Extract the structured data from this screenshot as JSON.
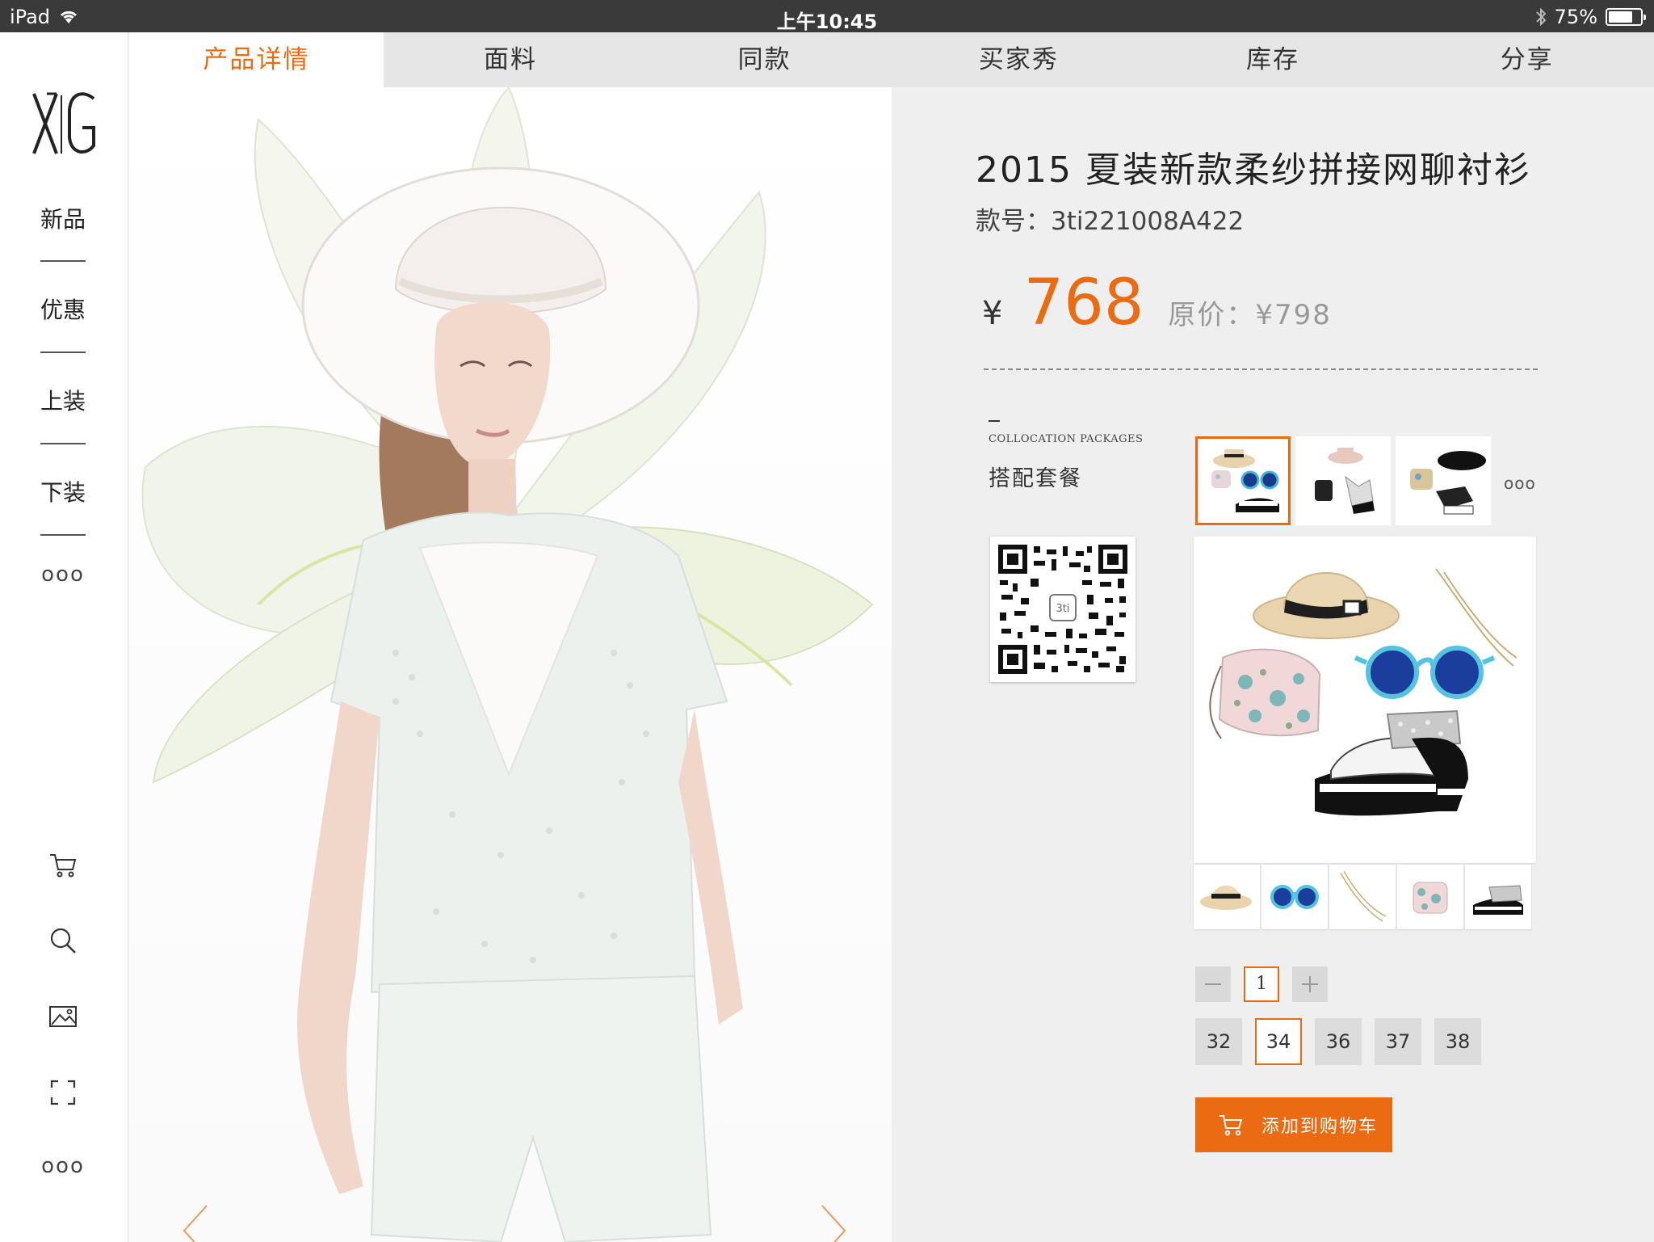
{
  "status_bar": {
    "device": "iPad",
    "time": "上午10:45",
    "battery": "75%",
    "battery_level": 0.75
  },
  "brand": {
    "logo_text": "XG"
  },
  "sidebar": {
    "items": [
      {
        "label": "新品"
      },
      {
        "label": "优惠"
      },
      {
        "label": "上装"
      },
      {
        "label": "下装"
      }
    ],
    "more": "ooo",
    "bottom_more": "ooo",
    "icons": [
      "cart-icon",
      "search-icon",
      "image-icon",
      "scan-icon"
    ]
  },
  "tabs": [
    {
      "label": "产品详情",
      "active": true
    },
    {
      "label": "面料"
    },
    {
      "label": "同款"
    },
    {
      "label": "买家秀"
    },
    {
      "label": "库存"
    },
    {
      "label": "分享"
    }
  ],
  "product": {
    "title": "2015 夏装新款柔纱拼接网聊衬衫",
    "sku": "款号：3ti221008A422",
    "currency": "¥",
    "price": "768",
    "original_price": "原价：¥798"
  },
  "package": {
    "title_en": "COLLOCATION PACKAGES",
    "title_cn": "搭配套餐",
    "more": "ooo",
    "qr_badge": "3ti"
  },
  "quantity": {
    "value": "1"
  },
  "sizes": [
    {
      "label": "32"
    },
    {
      "label": "34",
      "selected": true
    },
    {
      "label": "36"
    },
    {
      "label": "37"
    },
    {
      "label": "38"
    }
  ],
  "cart": {
    "label": "添加到购物车"
  },
  "colors": {
    "accent": "#ea6b12",
    "panel_bg": "#efefef",
    "tab_bg": "#e6e6e6",
    "status_bg": "#3a3a3a"
  }
}
